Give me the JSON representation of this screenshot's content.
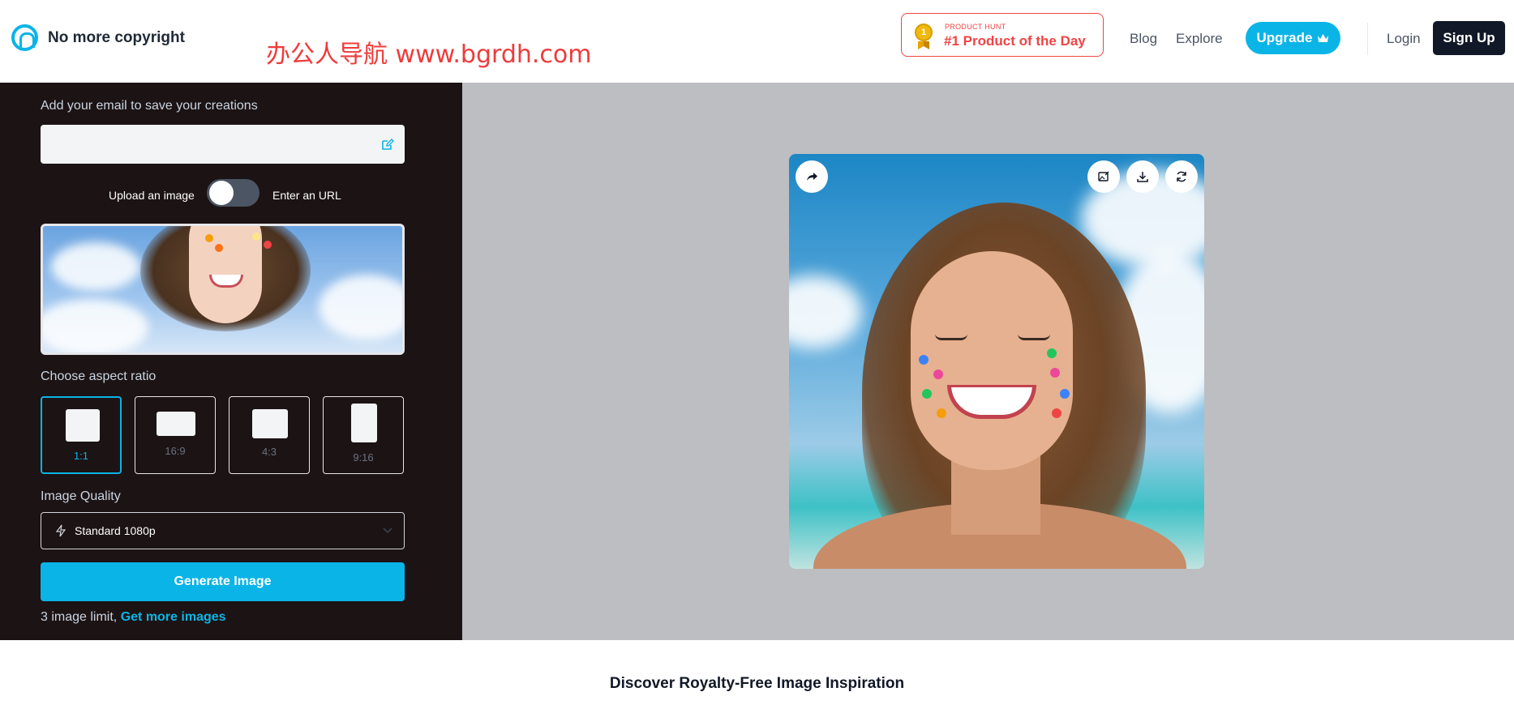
{
  "header": {
    "brand": "No more copyright",
    "watermark": "办公人导航 www.bgrdh.com",
    "product_hunt": {
      "small": "PRODUCT HUNT",
      "main": "#1 Product of the Day",
      "medal": "1"
    },
    "nav": {
      "blog": "Blog",
      "explore": "Explore"
    },
    "upgrade": "Upgrade",
    "login": "Login",
    "signup": "Sign Up"
  },
  "left": {
    "email_label": "Add your email to save your creations",
    "email_value": "",
    "upload_label": "Upload an image",
    "url_label": "Enter an URL",
    "aspect_label": "Choose aspect ratio",
    "ratios": [
      "1:1",
      "16:9",
      "4:3",
      "9:16"
    ],
    "selected_ratio": "1:1",
    "quality_label": "Image Quality",
    "quality_value": "Standard 1080p",
    "generate": "Generate Image",
    "limit_text": "3 image limit,",
    "limit_link": "Get more images"
  },
  "icons": [
    "logo-icon",
    "medal-icon",
    "crown-icon",
    "edit-icon",
    "bolt-icon",
    "chevron-down-icon",
    "share-icon",
    "image-edit-icon",
    "download-icon",
    "refresh-icon"
  ],
  "colors": {
    "accent": "#0bb4e6",
    "panel": "#1c1314",
    "canvas": "#bdbec2",
    "ph_red": "#ef4444",
    "dark_button": "#111827"
  },
  "footer": {
    "discover": "Discover Royalty-Free Image Inspiration"
  }
}
